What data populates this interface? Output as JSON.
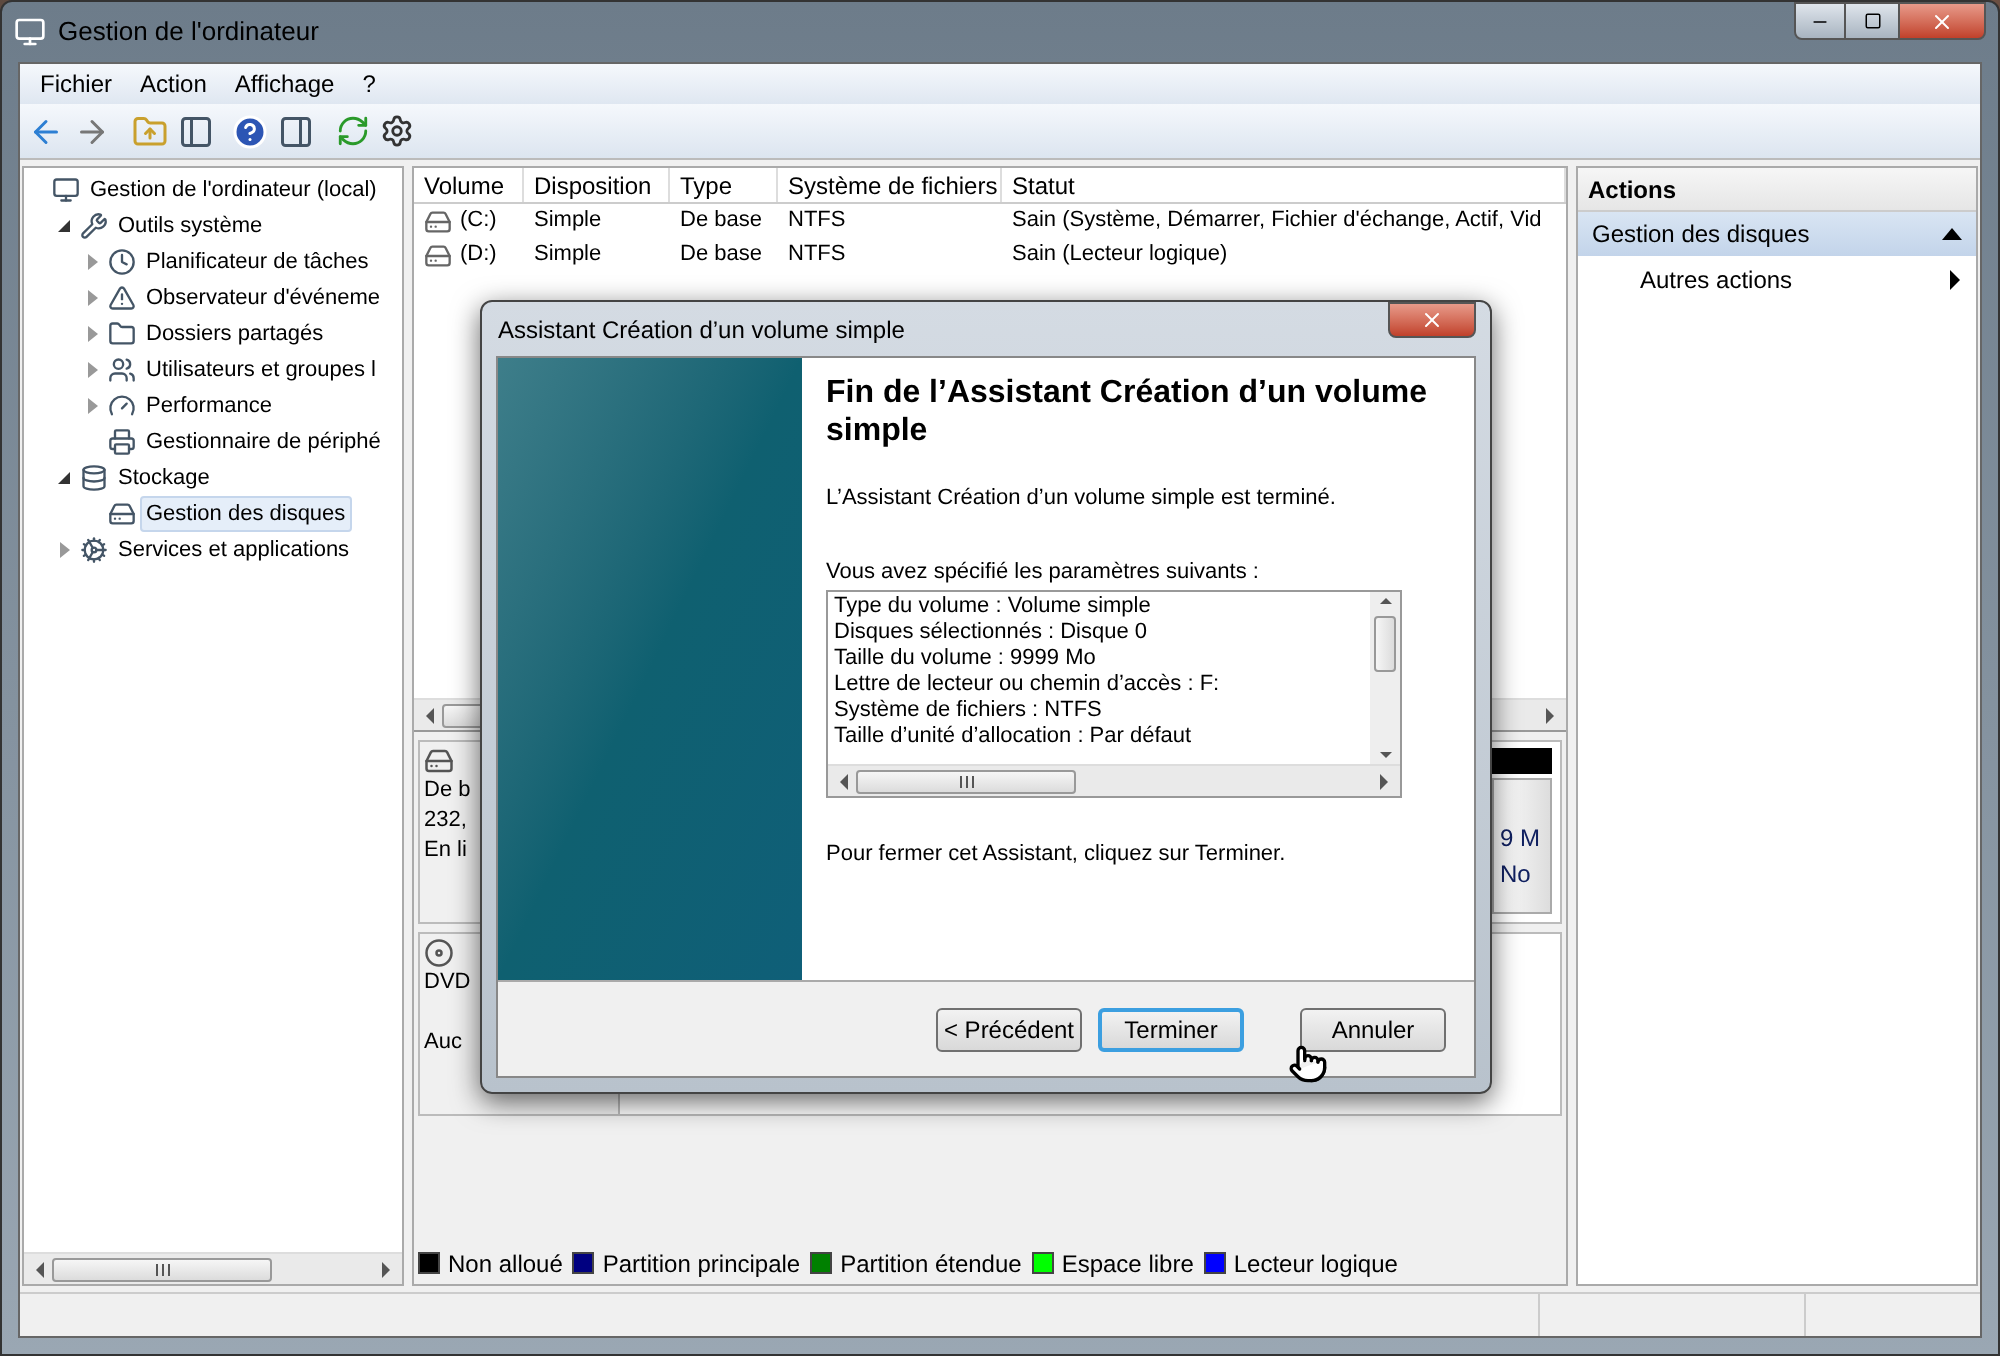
{
  "window": {
    "title": "Gestion de l'ordinateur"
  },
  "menu": [
    "Fichier",
    "Action",
    "Affichage",
    "?"
  ],
  "tree": [
    {
      "label": "Gestion de l'ordinateur (local)",
      "kind": "computer",
      "selected": false,
      "children": [
        {
          "label": "Outils système",
          "kind": "tools",
          "expanded": true,
          "selected": false,
          "children": [
            {
              "label": "Planificateur de tâches",
              "kind": "clock",
              "expanded": false,
              "selected": false
            },
            {
              "label": "Observateur d'événeme",
              "kind": "event",
              "expanded": false,
              "selected": false
            },
            {
              "label": "Dossiers partagés",
              "kind": "folder",
              "expanded": false,
              "selected": false
            },
            {
              "label": "Utilisateurs et groupes l",
              "kind": "users",
              "expanded": false,
              "selected": false
            },
            {
              "label": "Performance",
              "kind": "performance",
              "expanded": false,
              "selected": false
            },
            {
              "label": "Gestionnaire de périphé",
              "kind": "devices",
              "selected": false
            }
          ]
        },
        {
          "label": "Stockage",
          "kind": "storage",
          "expanded": true,
          "selected": false,
          "children": [
            {
              "label": "Gestion des disques",
              "kind": "disk",
              "selected": true
            }
          ]
        },
        {
          "label": "Services et applications",
          "kind": "services",
          "expanded": false,
          "selected": false
        }
      ]
    }
  ],
  "volumes": {
    "columns": [
      "Volume",
      "Disposition",
      "Type",
      "Système de fichiers",
      "Statut"
    ],
    "rows": [
      [
        "(C:)",
        "Simple",
        "De base",
        "NTFS",
        "Sain (Système, Démarrer, Fichier d'échange, Actif, Vid"
      ],
      [
        "(D:)",
        "Simple",
        "De base",
        "NTFS",
        "Sain (Lecteur logique)"
      ]
    ]
  },
  "disks": [
    {
      "kind": "disk",
      "lines": [
        "De b",
        "232,",
        "En li"
      ],
      "partition": [
        "9 M",
        "No"
      ]
    },
    {
      "kind": "dvd",
      "lines": [
        "DVD",
        "Auc"
      ]
    }
  ],
  "legend": [
    {
      "label": "Non alloué",
      "color": "#000000"
    },
    {
      "label": "Partition principale",
      "color": "#000080"
    },
    {
      "label": "Partition étendue",
      "color": "#008000"
    },
    {
      "label": "Espace libre",
      "color": "#00ff00"
    },
    {
      "label": "Lecteur logique",
      "color": "#0000ff"
    }
  ],
  "actions": {
    "title": "Actions",
    "sections": [
      {
        "label": "Gestion des disques",
        "selected": true,
        "items": [
          "Autres actions"
        ]
      }
    ]
  },
  "dialog": {
    "title": "Assistant Création d’un volume simple",
    "heading": "Fin de l’Assistant Création d’un volume simple",
    "intro": "L’Assistant Création d’un volume simple est terminé.",
    "settings_label": "Vous avez spécifié les paramètres suivants :",
    "settings": [
      "Type du volume : Volume simple",
      "Disques sélectionnés : Disque 0",
      "Taille du volume : 9999 Mo",
      "Lettre de lecteur ou chemin d’accès : F:",
      "Système de fichiers : NTFS",
      "Taille d’unité d’allocation : Par défaut"
    ],
    "closing": "Pour fermer cet Assistant, cliquez sur Terminer.",
    "buttons": [
      {
        "label": "< Précédent",
        "default": false
      },
      {
        "label": "Terminer",
        "default": true
      },
      {
        "label": "Annuler",
        "default": false
      }
    ]
  }
}
